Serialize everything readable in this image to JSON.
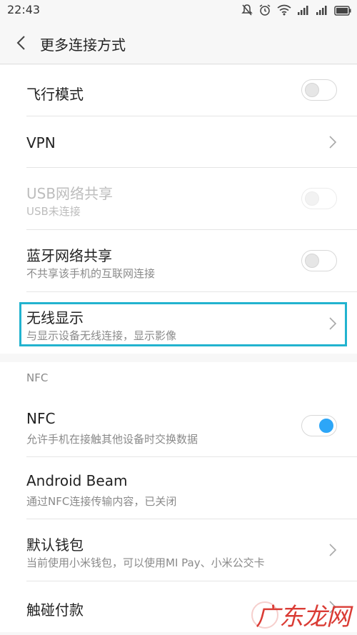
{
  "status_bar": {
    "time": "22:43",
    "icons": [
      "mute-icon",
      "alarm-icon",
      "wifi-icon",
      "signal-icon",
      "signal-icon",
      "battery-icon"
    ]
  },
  "header": {
    "title": "更多连接方式"
  },
  "items": [
    {
      "label": "飞行模式",
      "type": "toggle",
      "on": false
    },
    {
      "label": "VPN",
      "type": "chevron"
    },
    {
      "label": "USB网络共享",
      "subtitle": "USB未连接",
      "type": "toggle",
      "on": false,
      "disabled": true
    },
    {
      "label": "蓝牙网络共享",
      "subtitle": "不共享该手机的互联网连接",
      "type": "toggle",
      "on": false
    },
    {
      "label": "无线显示",
      "subtitle": "与显示设备无线连接，显示影像",
      "type": "chevron",
      "highlighted": true
    }
  ],
  "nfc_section": {
    "header": "NFC",
    "items": [
      {
        "label": "NFC",
        "subtitle": "允许手机在接触其他设备时交换数据",
        "type": "toggle",
        "on": true
      },
      {
        "label": "Android Beam",
        "subtitle": "通过NFC连接传输内容，已关闭",
        "type": "none"
      },
      {
        "label": "默认钱包",
        "subtitle": "当前使用小米钱包，可以使用MI Pay、小米公交卡",
        "type": "chevron"
      },
      {
        "label": "触碰付款",
        "type": "chevron"
      }
    ]
  },
  "watermark": "广东龙网",
  "colors": {
    "accent": "#2da6f7",
    "highlight": "#22b3cf",
    "watermark": "#d9322b"
  }
}
